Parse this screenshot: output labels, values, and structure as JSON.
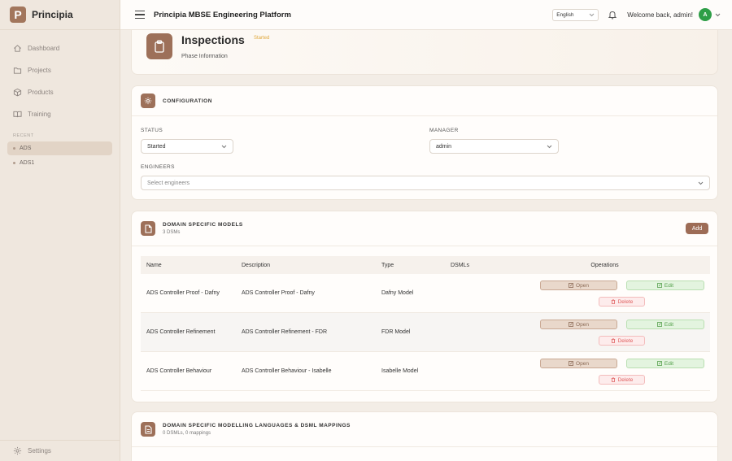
{
  "brand": {
    "logo_letter": "P",
    "name": "Principia"
  },
  "nav": [
    {
      "label": "Dashboard",
      "icon": "home-icon"
    },
    {
      "label": "Projects",
      "icon": "folder-icon"
    },
    {
      "label": "Products",
      "icon": "cube-icon"
    },
    {
      "label": "Training",
      "icon": "book-icon"
    }
  ],
  "recent": {
    "label": "RECENT",
    "items": [
      {
        "label": "ADS",
        "active": true
      },
      {
        "label": "ADS1",
        "active": false
      }
    ]
  },
  "settings_label": "Settings",
  "header": {
    "title": "Principia MBSE Engineering Platform",
    "language": "English",
    "welcome": "Welcome back, admin!",
    "avatar_letter": "A"
  },
  "phase": {
    "title": "Inspections",
    "status_badge": "Started",
    "subtitle": "Phase Information"
  },
  "configuration": {
    "title": "CONFIGURATION",
    "status_label": "STATUS",
    "status_value": "Started",
    "manager_label": "MANAGER",
    "manager_value": "admin",
    "engineers_label": "ENGINEERS",
    "engineers_placeholder": "Select engineers"
  },
  "dsm": {
    "title": "DOMAIN SPECIFIC MODELS",
    "count": "3 DSMs",
    "add_label": "Add",
    "columns": {
      "name": "Name",
      "description": "Description",
      "type": "Type",
      "dsmls": "DSMLs",
      "operations": "Operations"
    },
    "open_label": "Open",
    "edit_label": "Edit",
    "delete_label": "Delete",
    "rows": [
      {
        "name": "ADS Controller Proof - Dafny",
        "description": "ADS Controller Proof - Dafny",
        "type": "Dafny Model",
        "dsmls": ""
      },
      {
        "name": "ADS Controller Refinement",
        "description": "ADS Controller Refinement - FDR",
        "type": "FDR Model",
        "dsmls": ""
      },
      {
        "name": "ADS Controller Behaviour",
        "description": "ADS Controller Behaviour - Isabelle",
        "type": "Isabelle Model",
        "dsmls": ""
      }
    ]
  },
  "dsml": {
    "title": "DOMAIN SPECIFIC MODELLING LANGUAGES & DSML MAPPINGS",
    "count": "0 DSMLs, 0 mappings"
  },
  "colors": {
    "accent": "#9d7059",
    "sidebar_bg": "#efe7de",
    "avatar": "#2e9e47",
    "status_badge": "#e0a73a"
  }
}
